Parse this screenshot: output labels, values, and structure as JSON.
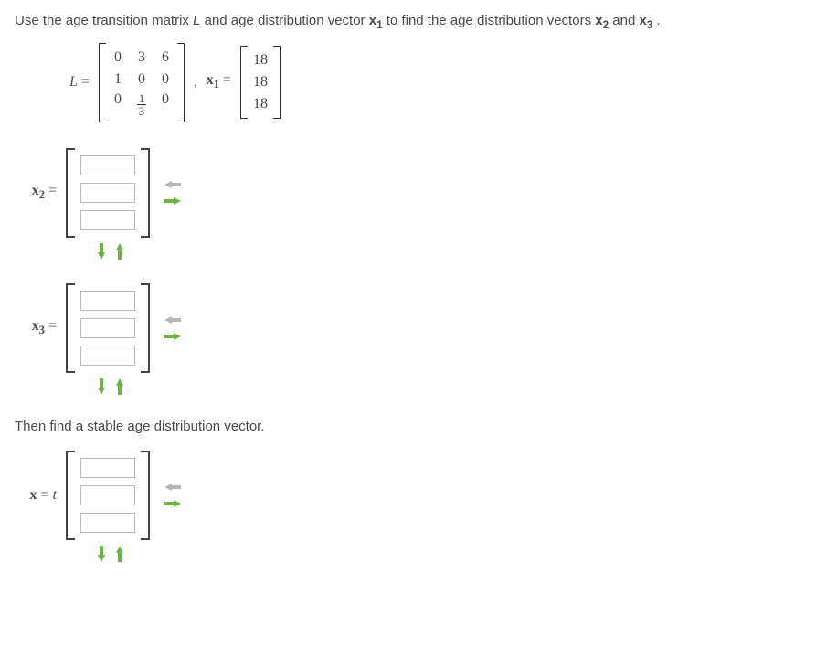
{
  "problem": {
    "intro_pre": "Use the age transition matrix ",
    "L_sym": "L",
    "intro_mid": " and age distribution vector ",
    "x1_sym": "x",
    "x1_sub": "1",
    "intro_post": " to find the age distribution vectors ",
    "x2_sym": "x",
    "x2_sub": "2",
    "intro_and": " and ",
    "x3_sym": "x",
    "x3_sub": "3",
    "intro_end": "."
  },
  "matrices": {
    "L_label_pre": "L",
    "eq": " = ",
    "L": [
      [
        "0",
        "3",
        "6"
      ],
      [
        "1",
        "0",
        "0"
      ],
      [
        "0",
        "frac",
        "0"
      ]
    ],
    "L_frac": {
      "num": "1",
      "den": "3"
    },
    "comma": ",",
    "x1_label": "x",
    "x1_sub": "1",
    "x1": [
      "18",
      "18",
      "18"
    ]
  },
  "answers": {
    "x2": {
      "sym": "x",
      "sub": "2",
      "eq": " = ",
      "rows": 3
    },
    "x3": {
      "sym": "x",
      "sub": "3",
      "eq": " = ",
      "rows": 3
    },
    "xt": {
      "prefix": "x",
      "eq": " = ",
      "t": "t",
      "rows": 3
    }
  },
  "stable_text": "Then find a stable age distribution vector.",
  "icons": {
    "arrow_left": "col-remove",
    "arrow_right": "col-add",
    "arrow_down": "row-add",
    "arrow_up": "row-remove"
  }
}
